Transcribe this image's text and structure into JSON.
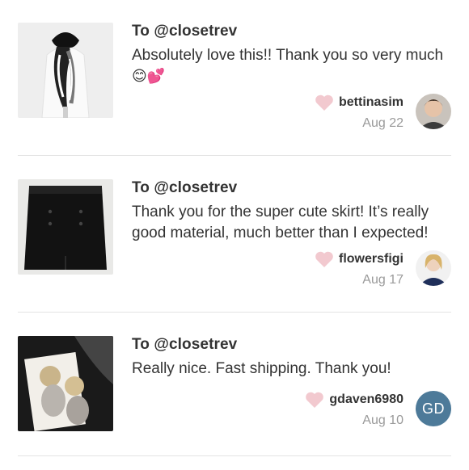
{
  "colors": {
    "heart": "#f2c9cf",
    "avatar_bg": "#4d7a99",
    "divider": "#e3e3e3"
  },
  "reviews": [
    {
      "to": "To @closetrev",
      "message": "Absolutely love this!! Thank you so very much",
      "emoji": "😊💕",
      "username": "bettinasim",
      "date": "Aug 22",
      "avatar": "photo",
      "product": "black and white scarf on mannequin"
    },
    {
      "to": "To @closetrev",
      "message": "Thank you for the super cute skirt! It’s really good material, much better than I expected!",
      "emoji": "",
      "username": "flowersfigi",
      "date": "Aug 17",
      "avatar": "photo",
      "product": "black pencil skirt"
    },
    {
      "to": "To @closetrev",
      "message": "Really nice. Fast shipping. Thank you!",
      "emoji": "",
      "username": "gdaven6980",
      "date": "Aug 10",
      "avatar_initials": "GD",
      "product": "gold and shell earrings"
    }
  ]
}
